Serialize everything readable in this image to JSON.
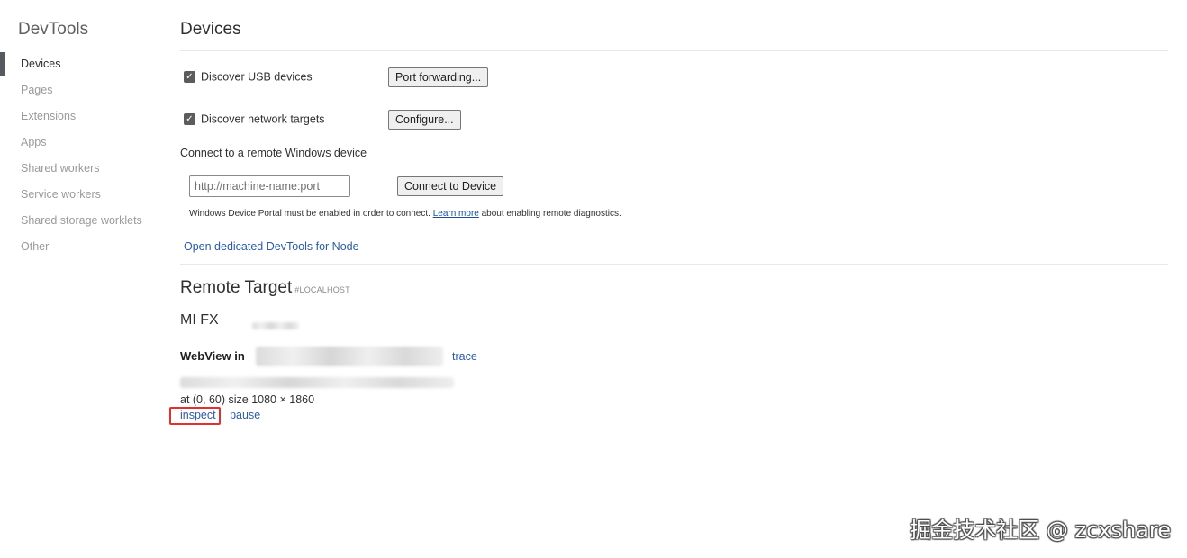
{
  "sidebar": {
    "title": "DevTools",
    "items": [
      {
        "label": "Devices",
        "active": true
      },
      {
        "label": "Pages",
        "active": false
      },
      {
        "label": "Extensions",
        "active": false
      },
      {
        "label": "Apps",
        "active": false
      },
      {
        "label": "Shared workers",
        "active": false
      },
      {
        "label": "Service workers",
        "active": false
      },
      {
        "label": "Shared storage worklets",
        "active": false
      },
      {
        "label": "Other",
        "active": false
      }
    ]
  },
  "devices": {
    "title": "Devices",
    "discover_usb": {
      "label": "Discover USB devices",
      "checked": true
    },
    "port_forwarding_button": "Port forwarding...",
    "discover_network": {
      "label": "Discover network targets",
      "checked": true
    },
    "configure_button": "Configure...",
    "remote_windows_label": "Connect to a remote Windows device",
    "remote_input_placeholder": "http://machine-name:port",
    "connect_button": "Connect to Device",
    "portal_note_before": "Windows Device Portal must be enabled in order to connect. ",
    "portal_note_link": "Learn more",
    "portal_note_after": " about enabling remote diagnostics.",
    "node_link": "Open dedicated DevTools for Node"
  },
  "remote_target": {
    "title": "Remote Target",
    "tag": "#LOCALHOST",
    "device_name": "MI FX",
    "webview_label": "WebView in",
    "trace_link": "trace",
    "target_meta": "at (0, 60)  size 1080 × 1860",
    "inspect_link": "inspect",
    "pause_link": "pause"
  },
  "watermark": "掘金技术社区 @ zcxshare",
  "colors": {
    "accent_link": "#2a5caa",
    "highlight_box": "#e03030",
    "active_indicator": "#555a60"
  }
}
